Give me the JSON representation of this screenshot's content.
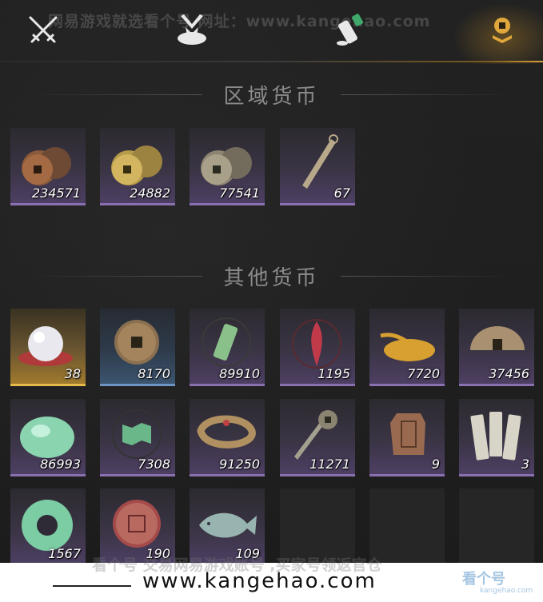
{
  "watermark_top": "网易游戏就选看个号  网址：www.kangehao.com",
  "tabs": [
    {
      "icon": "crossed-swords-icon",
      "active": false
    },
    {
      "icon": "bundle-icon",
      "active": false
    },
    {
      "icon": "scroll-icon",
      "active": false
    },
    {
      "icon": "currency-coins-icon",
      "active": true
    }
  ],
  "sections": {
    "regional": {
      "title": "区域货币",
      "items": [
        {
          "icon": "copper-coins-icon",
          "count": "234571",
          "style": "purple"
        },
        {
          "icon": "gold-coins-icon",
          "count": "24882",
          "style": "purple"
        },
        {
          "icon": "silver-coins-icon",
          "count": "77541",
          "style": "purple"
        },
        {
          "icon": "throwing-knife-icon",
          "count": "67",
          "style": "purple"
        }
      ]
    },
    "other": {
      "title": "其他货币",
      "items": [
        {
          "icon": "pearl-icon",
          "count": "38",
          "style": "gold"
        },
        {
          "icon": "ancient-coin-icon",
          "count": "8170",
          "style": "blue"
        },
        {
          "icon": "jade-token-icon",
          "count": "89910",
          "style": "purple"
        },
        {
          "icon": "red-flame-icon",
          "count": "1195",
          "style": "purple"
        },
        {
          "icon": "grain-pile-icon",
          "count": "7720",
          "style": "purple"
        },
        {
          "icon": "half-coin-icon",
          "count": "37456",
          "style": "purple"
        },
        {
          "icon": "jade-stone-icon",
          "count": "86993",
          "style": "purple"
        },
        {
          "icon": "jade-map-icon",
          "count": "7308",
          "style": "purple"
        },
        {
          "icon": "coin-string-icon",
          "count": "91250",
          "style": "purple"
        },
        {
          "icon": "coin-sword-icon",
          "count": "11271",
          "style": "purple"
        },
        {
          "icon": "bronze-plaque-icon",
          "count": "9",
          "style": "purple"
        },
        {
          "icon": "paper-slips-icon",
          "count": "3",
          "style": "purple"
        },
        {
          "icon": "jade-ring-icon",
          "count": "1567",
          "style": "purple"
        },
        {
          "icon": "red-seal-icon",
          "count": "190",
          "style": "purple"
        },
        {
          "icon": "jade-fish-icon",
          "count": "109",
          "style": "purple"
        }
      ]
    }
  },
  "bottom_bar": {
    "ghost_text": "看个号 交易网易游戏账号 ,买家号领返官仓",
    "site": "www.kangehao.com",
    "logo": "看个号",
    "logo_sub": "kangehao.com"
  },
  "colors": {
    "accent_gold": "#d9a13a",
    "tile_purple_edge": "#8a6fb1",
    "tile_gold_edge": "#e5b94a",
    "tile_blue_edge": "#6e94c4"
  }
}
